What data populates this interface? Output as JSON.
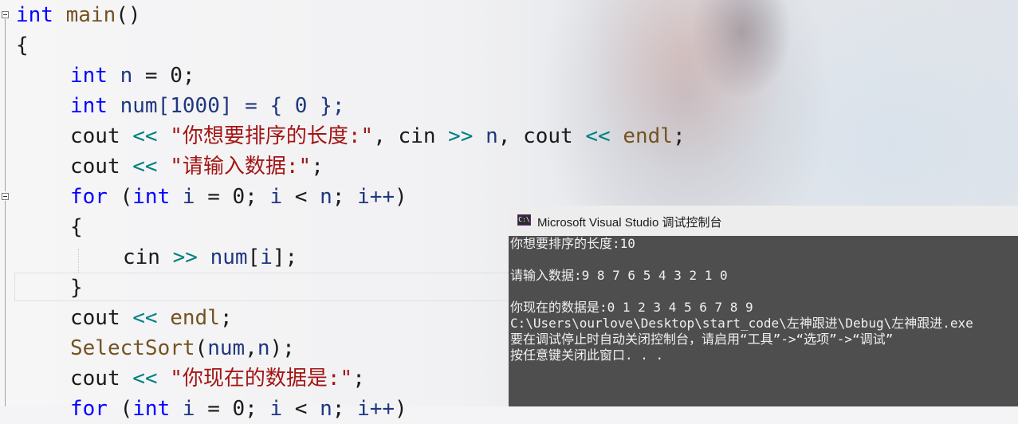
{
  "editor": {
    "lines": [
      {
        "text": "int main()"
      },
      {
        "text": "{"
      },
      {
        "text": "int n = 0;"
      },
      {
        "text": "int num[1000] = { 0 };"
      },
      {
        "text": "cout << \"你想要排序的长度:\", cin >> n, cout << endl;"
      },
      {
        "text": "cout << \"请输入数据:\";"
      },
      {
        "text": "for (int i = 0; i < n; i++)"
      },
      {
        "text": "{"
      },
      {
        "text": "cin >> num[i];"
      },
      {
        "text": "}"
      },
      {
        "text": "cout << endl;"
      },
      {
        "text": "SelectSort(num,n);"
      },
      {
        "text": "cout << \"你现在的数据是:\";"
      },
      {
        "text": "for (int i = 0; i < n; i++)"
      }
    ],
    "tokens": {
      "int": "int",
      "main": "main",
      "open_paren_close": "()",
      "brace_open": "{",
      "brace_close": "}",
      "n": "n",
      "eq_zero": " = 0;",
      "num_decl": "num[1000] = { 0 };",
      "cout": "cout",
      "shl": "<<",
      "shr": ">>",
      "str_length": "\"你想要排序的长度:\"",
      "comma": ",",
      "cin": "cin",
      "endl": "endl",
      "semi": ";",
      "str_input": "\"请输入数据:\"",
      "for": "for",
      "for_open": " (",
      "i": "i",
      "assign0": " = 0; ",
      "lt": " < ",
      "n2": "n",
      "semi_sp": "; ",
      "inc": "i++",
      "close": ")",
      "num": "num",
      "bracket_open": "[",
      "bracket_close": "];",
      "select_sort": "SelectSort",
      "sort_args_open": "(",
      "sort_num": "num",
      "sort_comma": ",",
      "sort_n": "n",
      "sort_close": ");",
      "str_now": "\"你现在的数据是:\""
    }
  },
  "console": {
    "title": "Microsoft Visual Studio 调试控制台",
    "icon": "console-icon",
    "output_lines": [
      "你想要排序的长度:10",
      "",
      "请输入数据:9 8 7 6 5 4 3 2 1 0",
      "",
      "你现在的数据是:0 1 2 3 4 5 6 7 8 9",
      "C:\\Users\\ourlove\\Desktop\\start_code\\左神跟进\\Debug\\左神跟进.exe",
      "要在调试停止时自动关闭控制台，请启用“工具”->“选项”->“调试”",
      "按任意键关闭此窗口. . ."
    ]
  },
  "colors": {
    "keyword": "#0000ff",
    "string": "#a31515",
    "function": "#74531f",
    "variable": "#1f377f",
    "operator": "#008080",
    "console_bg": "#4e4e4e",
    "console_title_bg": "#ededed"
  }
}
